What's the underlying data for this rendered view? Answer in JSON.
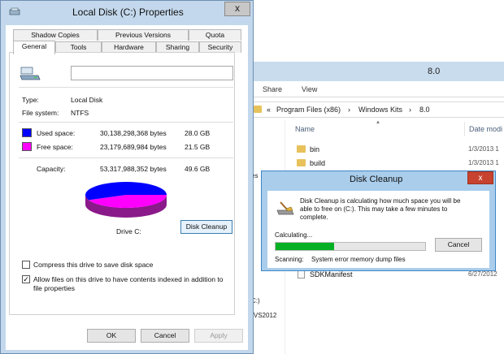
{
  "explorer": {
    "title": "8.0",
    "ribbon_tabs": [
      "Share",
      "View"
    ],
    "breadcrumb": [
      "«",
      "Program Files (x86)",
      "›",
      "Windows Kits",
      "›",
      "8.0"
    ],
    "left_pane": [
      "es",
      "C:)",
      ") VS2012"
    ],
    "columns": {
      "name": "Name",
      "date": "Date modi"
    },
    "files": [
      {
        "name": "bin",
        "date": "1/3/2013 1",
        "type": "folder"
      },
      {
        "name": "build",
        "date": "1/3/2013 1",
        "type": "folder"
      },
      {
        "name": "SDKManifest",
        "date": "6/27/2012",
        "type": "file"
      }
    ]
  },
  "properties": {
    "title": "Local Disk (C:) Properties",
    "close_glyph": "x",
    "tabs_top": [
      "Shadow Copies",
      "Previous Versions",
      "Quota"
    ],
    "tabs_bottom": [
      "General",
      "Tools",
      "Hardware",
      "Sharing",
      "Security"
    ],
    "active_tab": "General",
    "type_label": "Type:",
    "type_value": "Local Disk",
    "fs_label": "File system:",
    "fs_value": "NTFS",
    "used_label": "Used space:",
    "used_bytes": "30,138,298,368 bytes",
    "used_gb": "28.0 GB",
    "free_label": "Free space:",
    "free_bytes": "23,179,689,984 bytes",
    "free_gb": "21.5 GB",
    "capacity_label": "Capacity:",
    "capacity_bytes": "53,317,988,352 bytes",
    "capacity_gb": "49.6 GB",
    "used_fraction": 0.5653,
    "used_color": "#0000ff",
    "free_color": "#ff00ff",
    "drive_label": "Drive C:",
    "disk_cleanup_button": "Disk Cleanup",
    "compress_label": "Compress this drive to save disk space",
    "compress_checked": false,
    "index_label_line1": "Allow files on this drive to have contents indexed in addition to",
    "index_label_line2": "file properties",
    "index_checked": true,
    "ok_button": "OK",
    "cancel_button": "Cancel",
    "apply_button": "Apply"
  },
  "cleanup": {
    "title": "Disk Cleanup",
    "close_glyph": "x",
    "message_line1": "Disk Cleanup is calculating how much space you will be",
    "message_line2": "able to free on  (C:). This may take a few minutes to",
    "message_line3": "complete.",
    "calculating_label": "Calculating...",
    "progress": 0.39,
    "cancel_button": "Cancel",
    "scanning_label": "Scanning:",
    "scanning_value": "System error memory dump files"
  }
}
